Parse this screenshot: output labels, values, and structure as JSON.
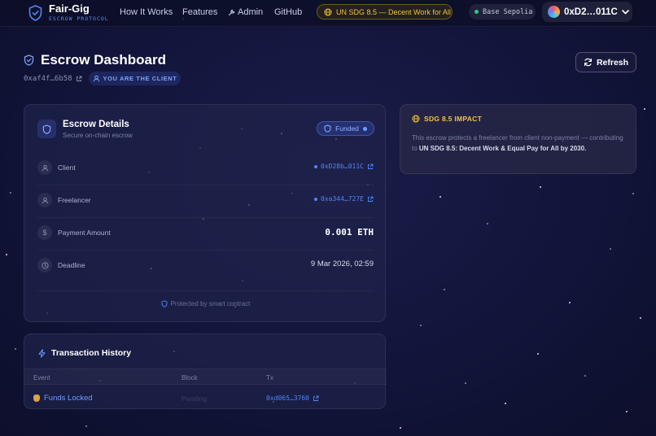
{
  "nav": {
    "brand_name": "Fair-Gig",
    "brand_sub": "ESCROW PROTOCOL",
    "links": [
      "How It Works",
      "Features",
      "Admin",
      "GitHub"
    ],
    "sdg_pill": "UN SDG 8.5 — Decent Work for All",
    "network": "Base Sepolia",
    "wallet": "0xD2…011C"
  },
  "header": {
    "title": "Escrow Dashboard",
    "contract_address": "0xaf4f…6b58",
    "role_badge": "YOU ARE THE CLIENT",
    "refresh_label": "Refresh"
  },
  "escrow": {
    "title": "Escrow Details",
    "subtitle": "Secure on-chain escrow",
    "status": "Funded",
    "rows": [
      {
        "label": "Client",
        "value": "0xD28b…011C",
        "icon": "user-icon"
      },
      {
        "label": "Freelancer",
        "value": "0xa344…727E",
        "icon": "user-icon"
      },
      {
        "label": "Payment Amount",
        "value": "0.001 ETH",
        "icon": "dollar-icon"
      },
      {
        "label": "Deadline",
        "value": "9 Mar 2026, 02:59",
        "icon": "clock-icon"
      }
    ],
    "protected_note": "Protected by smart contract"
  },
  "impact": {
    "title": "SDG 8.5 IMPACT",
    "text_before": "This escrow protects a freelancer from client non-payment — contributing to ",
    "text_bold": "UN SDG 8.5: Decent Work & Equal Pay for All by 2030."
  },
  "history": {
    "title": "Transaction History",
    "columns": [
      "Event",
      "Block",
      "Tx"
    ],
    "rows": [
      {
        "event": "Funds Locked",
        "block": "Pending",
        "tx": "0xd065…3760"
      }
    ]
  },
  "colors": {
    "accent": "#4f86f7",
    "sdg_gold": "#f2c33a",
    "background": "#12143a"
  }
}
